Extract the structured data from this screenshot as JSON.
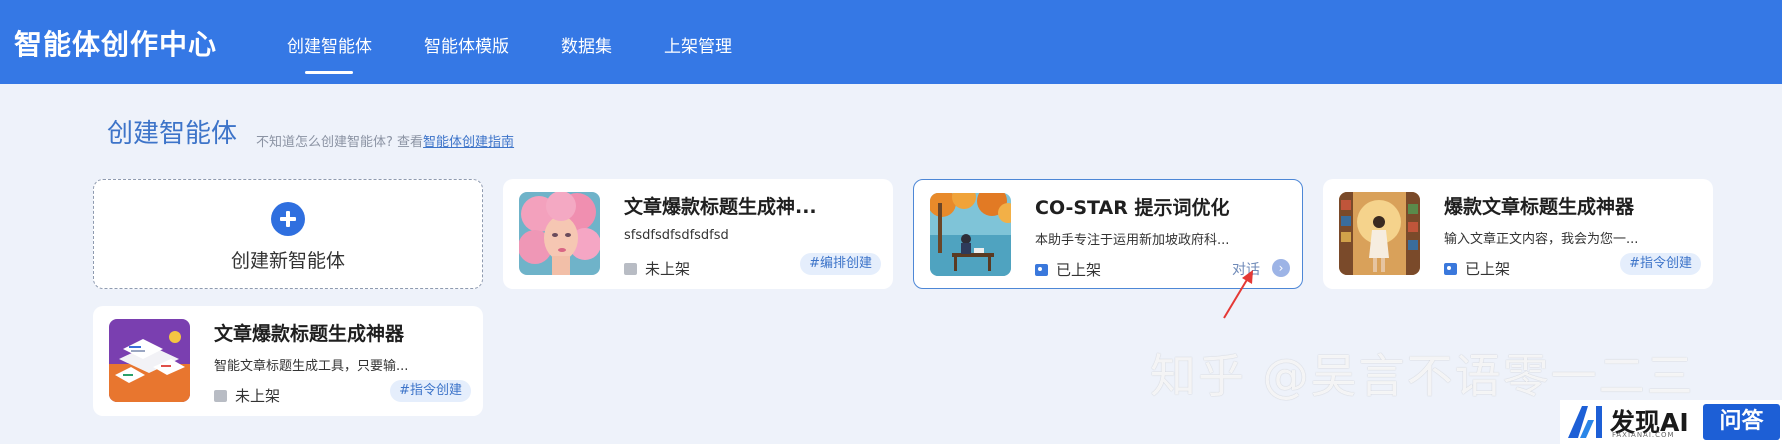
{
  "header": {
    "brand": "智能体创作中心",
    "nav": [
      "创建智能体",
      "智能体模版",
      "数据集",
      "上架管理"
    ]
  },
  "main": {
    "title": "创建智能体",
    "hint_prefix": "不知道怎么创建智能体? 查看",
    "hint_link": "智能体创建指南"
  },
  "create_card": {
    "label": "创建新智能体"
  },
  "cards": [
    {
      "title": "文章爆款标题生成神...",
      "desc": "sfsdfsdfsdfsdfsd",
      "status": "未上架",
      "tag": "#编排创建",
      "thumb_icon": "pink-hair-portrait-image"
    },
    {
      "title": "CO-STAR 提示词优化",
      "desc": "本助手专注于运用新加坡政府科...",
      "status": "已上架",
      "chat": "对话",
      "thumb_icon": "lakeside-reading-image"
    },
    {
      "title": "爆款文章标题生成神器",
      "desc": "输入文章正文内容，我会为您一...",
      "status": "已上架",
      "tag": "#指令创建",
      "thumb_icon": "library-reader-image"
    },
    {
      "title": "文章爆款标题生成神器",
      "desc": "智能文章标题生成工具，只要输...",
      "status": "未上架",
      "tag": "#指令创建",
      "thumb_icon": "documents-isometric-image"
    }
  ],
  "watermark": "知乎 @吴言不语零一二三",
  "badge": {
    "name": "发现AI",
    "sub": "FAXIANAI.COM",
    "qa": "问答"
  },
  "colors": {
    "primary": "#3578e5",
    "page_bg": "#eef2fa",
    "tag_bg": "#e5eefc",
    "accent_text": "#3d74c9"
  }
}
